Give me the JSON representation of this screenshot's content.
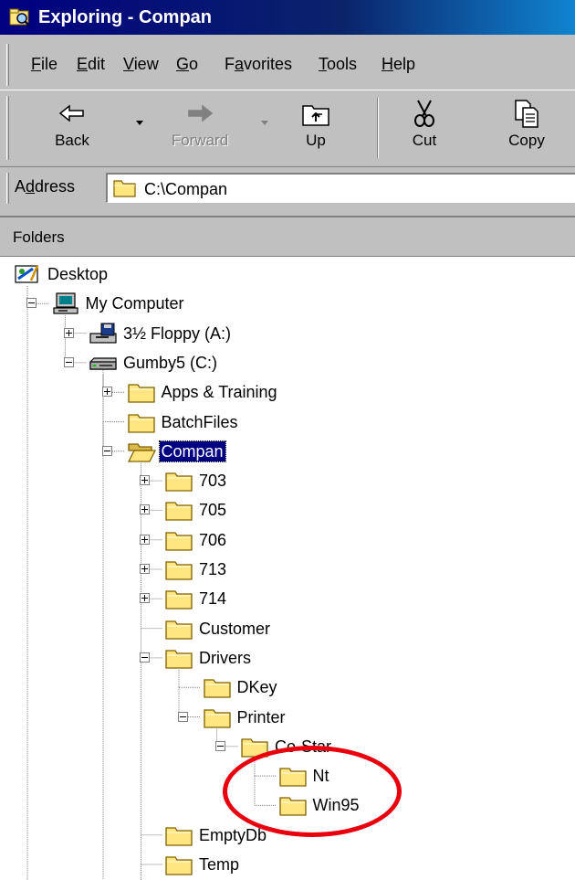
{
  "window": {
    "title": "Exploring - Compan"
  },
  "menubar": {
    "items": [
      {
        "label": "File",
        "accel_index": 0
      },
      {
        "label": "Edit",
        "accel_index": 0
      },
      {
        "label": "View",
        "accel_index": 0
      },
      {
        "label": "Go",
        "accel_index": 0
      },
      {
        "label": "Favorites",
        "accel_index": 1
      },
      {
        "label": "Tools",
        "accel_index": 0
      },
      {
        "label": "Help",
        "accel_index": 0
      }
    ]
  },
  "toolbar": {
    "back_label": "Back",
    "forward_label": "Forward",
    "up_label": "Up",
    "cut_label": "Cut",
    "copy_label": "Copy",
    "forward_enabled": false
  },
  "address": {
    "label": "Address",
    "accel_index": 1,
    "value": "C:\\Compan"
  },
  "folders_pane": {
    "header": "Folders"
  },
  "tree": {
    "nodes": [
      {
        "label": "Desktop",
        "icon": "desktop-icon",
        "expander": "none"
      },
      {
        "label": "My Computer",
        "icon": "my-computer-icon",
        "expander": "minus"
      },
      {
        "label": "3½ Floppy (A:)",
        "icon": "floppy-drive-icon",
        "expander": "plus"
      },
      {
        "label": "Gumby5 (C:)",
        "icon": "hard-drive-icon",
        "expander": "minus"
      },
      {
        "label": "Apps & Training",
        "icon": "folder-icon",
        "expander": "plus"
      },
      {
        "label": "BatchFiles",
        "icon": "folder-icon",
        "expander": "none"
      },
      {
        "label": "Compan",
        "icon": "open-folder-icon",
        "expander": "minus",
        "selected": true
      },
      {
        "label": "703",
        "icon": "folder-icon",
        "expander": "plus"
      },
      {
        "label": "705",
        "icon": "folder-icon",
        "expander": "plus"
      },
      {
        "label": "706",
        "icon": "folder-icon",
        "expander": "plus"
      },
      {
        "label": "713",
        "icon": "folder-icon",
        "expander": "plus"
      },
      {
        "label": "714",
        "icon": "folder-icon",
        "expander": "plus"
      },
      {
        "label": "Customer",
        "icon": "folder-icon",
        "expander": "none"
      },
      {
        "label": "Drivers",
        "icon": "folder-icon",
        "expander": "minus"
      },
      {
        "label": "DKey",
        "icon": "folder-icon",
        "expander": "none"
      },
      {
        "label": "Printer",
        "icon": "folder-icon",
        "expander": "minus"
      },
      {
        "label": "Co-Star",
        "icon": "folder-icon",
        "expander": "minus"
      },
      {
        "label": "Nt",
        "icon": "folder-icon",
        "expander": "none"
      },
      {
        "label": "Win95",
        "icon": "folder-icon",
        "expander": "none"
      },
      {
        "label": "EmptyDb",
        "icon": "folder-icon",
        "expander": "none"
      },
      {
        "label": "Temp",
        "icon": "folder-icon",
        "expander": "none"
      }
    ]
  },
  "colors": {
    "titlebar": "#000080",
    "face": "#c0c0c0",
    "selection": "#000080",
    "folder": "#ffe680",
    "annotation": "#e8000f"
  }
}
